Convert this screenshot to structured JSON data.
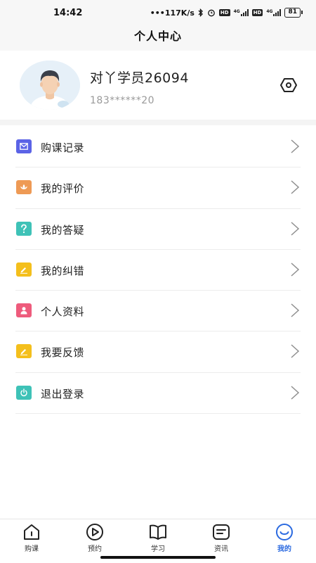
{
  "status_bar": {
    "time": "14:42",
    "net_speed": "•••117K/s",
    "hd1": "HD",
    "net1": "4G",
    "hd2": "HD",
    "net2": "4G",
    "battery": "81"
  },
  "header": {
    "title": "个人中心"
  },
  "profile": {
    "name": "对丫学员26094",
    "phone": "183******20",
    "settings_icon": "hexagon-settings-icon"
  },
  "menu": [
    {
      "label": "购课记录",
      "icon": "mail-icon",
      "color": "#5b63e6"
    },
    {
      "label": "我的评价",
      "icon": "flower-icon",
      "color": "#ee9a55"
    },
    {
      "label": "我的答疑",
      "icon": "question-icon",
      "color": "#3ec2b7"
    },
    {
      "label": "我的纠错",
      "icon": "pencil-icon",
      "color": "#f4bf1c"
    },
    {
      "label": "个人资料",
      "icon": "person-icon",
      "color": "#ee5b7c"
    },
    {
      "label": "我要反馈",
      "icon": "pencil-icon",
      "color": "#f4bf1c"
    },
    {
      "label": "退出登录",
      "icon": "power-icon",
      "color": "#3ec2b7"
    }
  ],
  "bottom_nav": [
    {
      "label": "购课",
      "icon": "home-icon"
    },
    {
      "label": "预约",
      "icon": "play-circle-icon"
    },
    {
      "label": "学习",
      "icon": "book-icon"
    },
    {
      "label": "资讯",
      "icon": "message-icon"
    },
    {
      "label": "我的",
      "icon": "smile-icon",
      "active": true
    }
  ],
  "colors": {
    "accent": "#2b6ae0",
    "menu_divider": "#ececec"
  }
}
